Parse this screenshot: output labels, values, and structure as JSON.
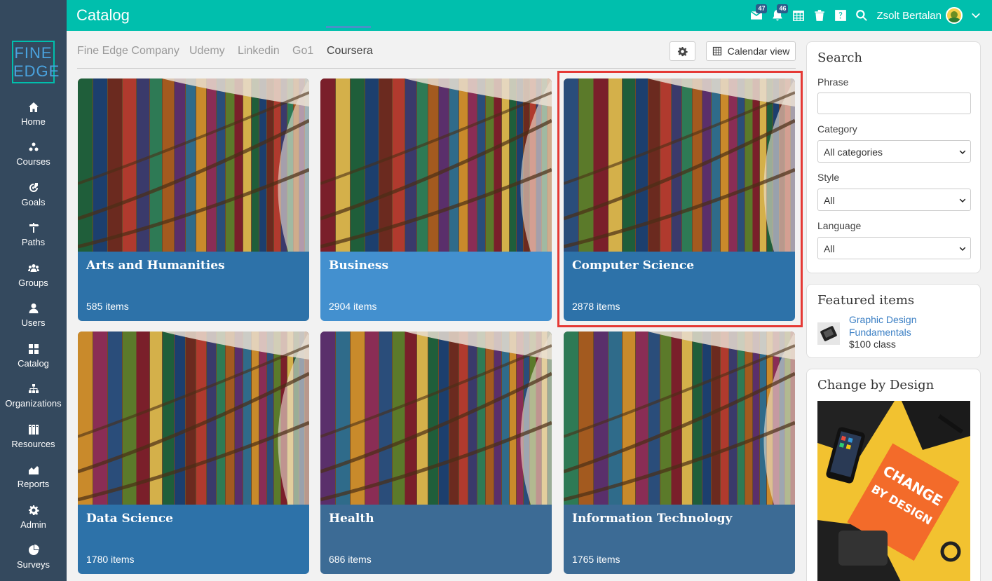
{
  "header": {
    "title": "Catalog",
    "messages_badge": "47",
    "notifications_badge": "46",
    "user_name": "Zsolt Bertalan"
  },
  "sidebar": {
    "logo_line1": "FINE",
    "logo_line2": "EDGE",
    "items": [
      {
        "label": "Home",
        "icon": "home-icon"
      },
      {
        "label": "Courses",
        "icon": "courses-icon"
      },
      {
        "label": "Goals",
        "icon": "goals-icon"
      },
      {
        "label": "Paths",
        "icon": "paths-icon"
      },
      {
        "label": "Groups",
        "icon": "groups-icon"
      },
      {
        "label": "Users",
        "icon": "user-icon"
      },
      {
        "label": "Catalog",
        "icon": "catalog-icon"
      },
      {
        "label": "Organizations",
        "icon": "organizations-icon"
      },
      {
        "label": "Resources",
        "icon": "resources-icon"
      },
      {
        "label": "Reports",
        "icon": "reports-icon"
      },
      {
        "label": "Admin",
        "icon": "gear-icon"
      },
      {
        "label": "Surveys",
        "icon": "surveys-icon"
      }
    ]
  },
  "tabs": [
    {
      "label": "Fine Edge Company",
      "active": false
    },
    {
      "label": "Udemy",
      "active": false
    },
    {
      "label": "Linkedin",
      "active": false
    },
    {
      "label": "Go1",
      "active": false
    },
    {
      "label": "Coursera",
      "active": true
    }
  ],
  "toolbar": {
    "calendar_label": "Calendar view"
  },
  "cards": [
    {
      "title": "Arts and Humanities",
      "count": "585 items",
      "color": "#2d72a9"
    },
    {
      "title": "Business",
      "count": "2904 items",
      "color": "#4390cf"
    },
    {
      "title": "Computer Science",
      "count": "2878 items",
      "color": "#2d72a9"
    },
    {
      "title": "Data Science",
      "count": "1780 items",
      "color": "#2d72a9"
    },
    {
      "title": "Health",
      "count": "686 items",
      "color": "#3c6b95"
    },
    {
      "title": "Information Technology",
      "count": "1765 items",
      "color": "#3c6b95"
    }
  ],
  "search": {
    "title": "Search",
    "phrase_label": "Phrase",
    "phrase_value": "",
    "category_label": "Category",
    "category_value": "All categories",
    "style_label": "Style",
    "style_value": "All",
    "language_label": "Language",
    "language_value": "All"
  },
  "featured": {
    "title": "Featured items",
    "item_title": "Graphic Design Fundamentals",
    "item_price": "$100 class"
  },
  "promo": {
    "title": "Change by Design",
    "book_text_1": "CHANGE",
    "book_text_2": "BY DESIGN"
  },
  "colors": {
    "topbar": "#00bfad",
    "sidebar": "#34495e",
    "highlight": "#e53935"
  }
}
